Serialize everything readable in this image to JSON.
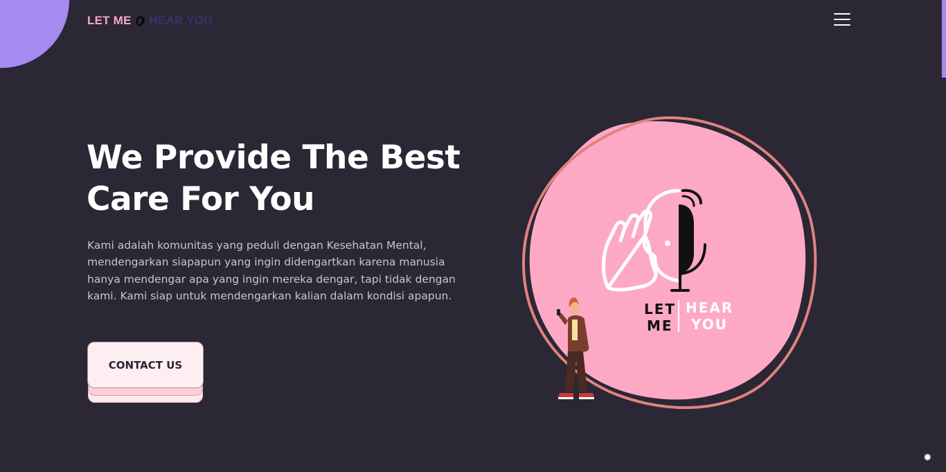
{
  "brand": {
    "part1": "LET ME",
    "part2": "HEAR YOU",
    "icon": "ear-icon"
  },
  "nav": {
    "menu_icon": "hamburger-menu-icon"
  },
  "hero": {
    "title_line1": "We Provide The Best",
    "title_line2": "Care For You",
    "description": "Kami adalah komunitas yang peduli dengan Kesehatan Mental, mendengarkan siapapun yang ingin didengartkan karena manusia hanya mendengar apa yang ingin mereka dengar, tapi tidak dengan kami. Kami siap untuk mendengarkan kalian dalam kondisi apapun.",
    "cta_label": "CONTACT US"
  },
  "illustration": {
    "logo_left_top": "LET",
    "logo_left_bottom": "ME",
    "logo_right_top": "HEAR",
    "logo_right_bottom": "YOU"
  },
  "colors": {
    "background": "#2b2735",
    "accent_purple": "#a58af0",
    "accent_pink": "#fda9c6",
    "ring": "#e0837f"
  },
  "widgets": {
    "settings_icon": "gear-icon",
    "settings_glyph": "✹"
  }
}
